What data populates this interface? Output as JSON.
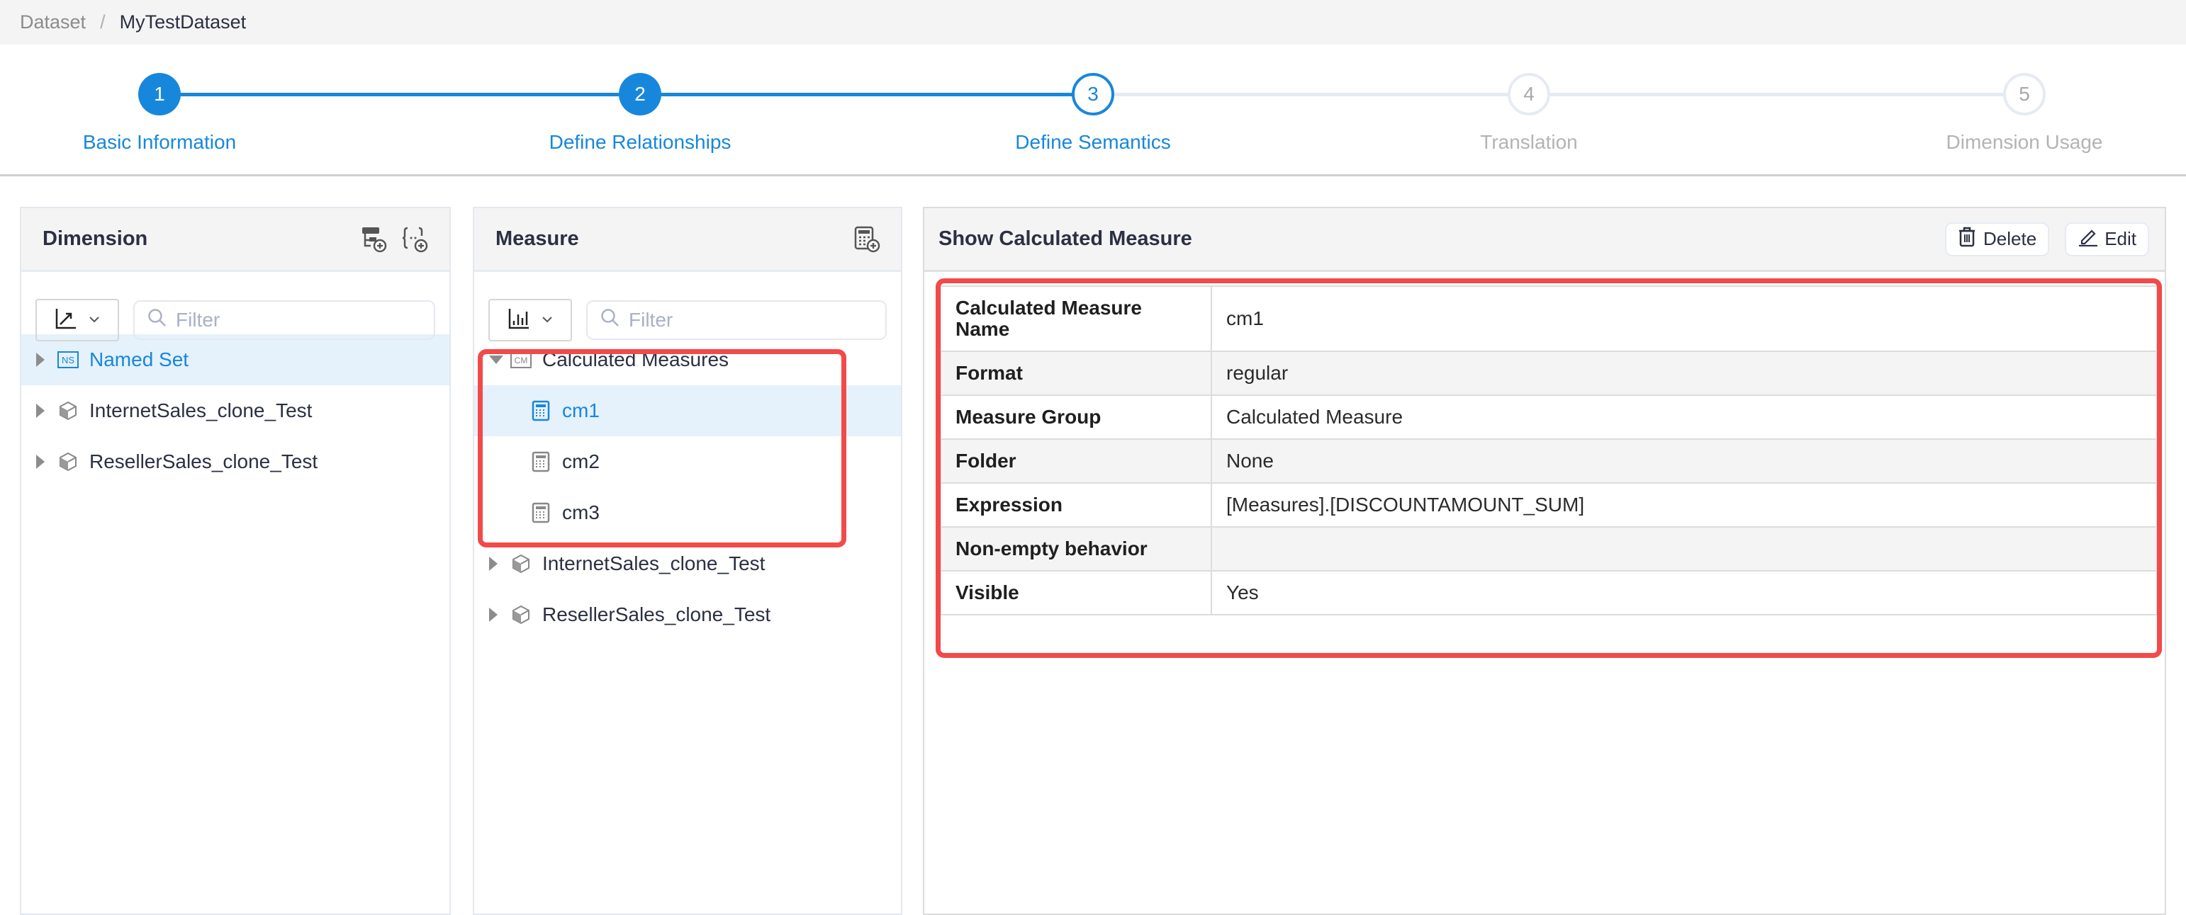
{
  "breadcrumb": {
    "root": "Dataset",
    "separator": "/",
    "current": "MyTestDataset"
  },
  "steps": [
    {
      "number": "1",
      "label": "Basic Information",
      "state": "done"
    },
    {
      "number": "2",
      "label": "Define Relationships",
      "state": "done"
    },
    {
      "number": "3",
      "label": "Define Semantics",
      "state": "active"
    },
    {
      "number": "4",
      "label": "Translation",
      "state": "todo"
    },
    {
      "number": "5",
      "label": "Dimension Usage",
      "state": "todo"
    }
  ],
  "colors": {
    "accent": "#1787dc",
    "highlight": "#f24a4a",
    "selected_bg": "#e5f1fb"
  },
  "dimension_panel": {
    "title": "Dimension",
    "header_icons": [
      "add-hierarchy-icon",
      "add-named-set-icon"
    ],
    "type_select_icon": "trend-chart-icon",
    "filter_placeholder": "Filter",
    "items": [
      {
        "label": "Named Set",
        "icon": "named-set-icon",
        "icon_text": "NS",
        "selected": true
      },
      {
        "label": "InternetSales_clone_Test",
        "icon": "cube-icon",
        "selected": false
      },
      {
        "label": "ResellerSales_clone_Test",
        "icon": "cube-icon",
        "selected": false
      }
    ]
  },
  "measure_panel": {
    "title": "Measure",
    "header_icons": [
      "add-calculated-measure-icon"
    ],
    "type_select_icon": "bar-chart-icon",
    "filter_placeholder": "Filter",
    "group": {
      "label": "Calculated Measures",
      "icon_text": "CM",
      "expanded": true,
      "children": [
        {
          "label": "cm1",
          "selected": true
        },
        {
          "label": "cm2",
          "selected": false
        },
        {
          "label": "cm3",
          "selected": false
        }
      ]
    },
    "items": [
      {
        "label": "InternetSales_clone_Test"
      },
      {
        "label": "ResellerSales_clone_Test"
      }
    ]
  },
  "detail_panel": {
    "title": "Show Calculated Measure",
    "delete_label": "Delete",
    "edit_label": "Edit",
    "rows": [
      {
        "key": "Calculated Measure Name",
        "value": "cm1"
      },
      {
        "key": "Format",
        "value": "regular"
      },
      {
        "key": "Measure Group",
        "value": "Calculated Measure"
      },
      {
        "key": "Folder",
        "value": "None"
      },
      {
        "key": "Expression",
        "value": "[Measures].[DISCOUNTAMOUNT_SUM]"
      },
      {
        "key": "Non-empty behavior",
        "value": ""
      },
      {
        "key": "Visible",
        "value": "Yes"
      }
    ]
  }
}
